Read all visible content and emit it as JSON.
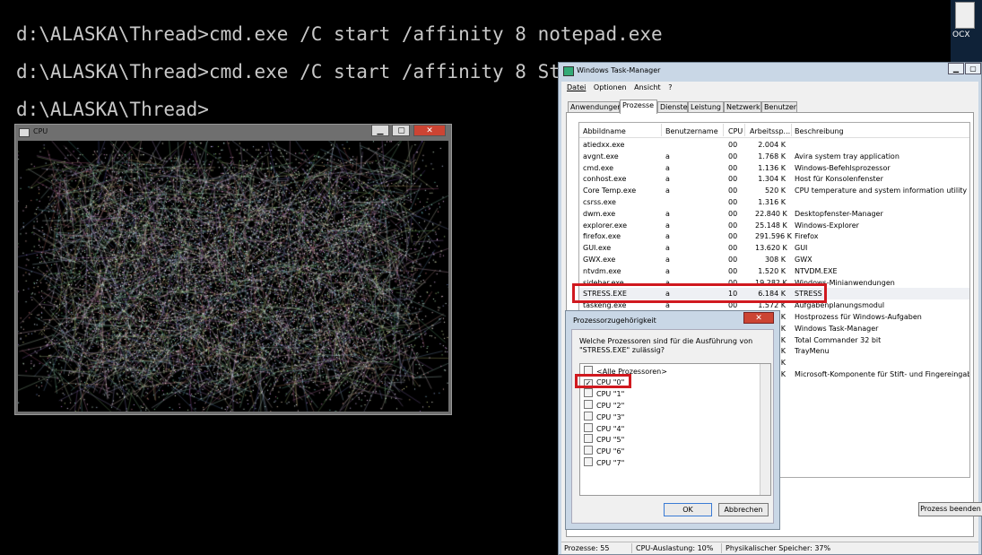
{
  "console": {
    "lines": [
      "d:\\ALASKA\\Thread>cmd.exe /C start /affinity 8 notepad.exe",
      "d:\\ALASKA\\Thread>cmd.exe /C start /affinity 8 St",
      "d:\\ALASKA\\Thread>"
    ]
  },
  "desktop": {
    "icon_label": "OCX"
  },
  "cpu_window": {
    "title": "CPU",
    "close_glyph": "✕",
    "min_glyph": "▁",
    "max_glyph": "▢"
  },
  "task_manager": {
    "title": "Windows Task-Manager",
    "menu": [
      "Datei",
      "Optionen",
      "Ansicht",
      "?"
    ],
    "tabs": [
      "Anwendungen",
      "Prozesse",
      "Dienste",
      "Leistung",
      "Netzwerk",
      "Benutzer"
    ],
    "active_tab": "Prozesse",
    "columns": [
      "Abbildname",
      "Benutzername",
      "CPU",
      "Arbeitssp...",
      "Beschreibung"
    ],
    "rows": [
      {
        "name": "atiedxx.exe",
        "user": "",
        "cpu": "00",
        "mem": "2.004 K",
        "desc": ""
      },
      {
        "name": "avgnt.exe",
        "user": "a",
        "cpu": "00",
        "mem": "1.768 K",
        "desc": "Avira system tray application"
      },
      {
        "name": "cmd.exe",
        "user": "a",
        "cpu": "00",
        "mem": "1.136 K",
        "desc": "Windows-Befehlsprozessor"
      },
      {
        "name": "conhost.exe",
        "user": "a",
        "cpu": "00",
        "mem": "1.304 K",
        "desc": "Host für Konsolenfenster"
      },
      {
        "name": "Core Temp.exe",
        "user": "a",
        "cpu": "00",
        "mem": "520 K",
        "desc": "CPU temperature and system information utility"
      },
      {
        "name": "csrss.exe",
        "user": "",
        "cpu": "00",
        "mem": "1.316 K",
        "desc": ""
      },
      {
        "name": "dwm.exe",
        "user": "a",
        "cpu": "00",
        "mem": "22.840 K",
        "desc": "Desktopfenster-Manager"
      },
      {
        "name": "explorer.exe",
        "user": "a",
        "cpu": "00",
        "mem": "25.148 K",
        "desc": "Windows-Explorer"
      },
      {
        "name": "firefox.exe",
        "user": "a",
        "cpu": "00",
        "mem": "291.596 K",
        "desc": "Firefox"
      },
      {
        "name": "GUI.exe",
        "user": "a",
        "cpu": "00",
        "mem": "13.620 K",
        "desc": "GUI"
      },
      {
        "name": "GWX.exe",
        "user": "a",
        "cpu": "00",
        "mem": "308 K",
        "desc": "GWX"
      },
      {
        "name": "ntvdm.exe",
        "user": "a",
        "cpu": "00",
        "mem": "1.520 K",
        "desc": "NTVDM.EXE"
      },
      {
        "name": "sidebar.exe",
        "user": "a",
        "cpu": "00",
        "mem": "19.282 K",
        "desc": "Windows-Minianwendungen"
      },
      {
        "name": "STRESS.EXE",
        "user": "a",
        "cpu": "10",
        "mem": "6.184 K",
        "desc": "STRESS"
      },
      {
        "name": "taskeng.exe",
        "user": "a",
        "cpu": "00",
        "mem": "1.572 K",
        "desc": "Aufgabenplanungsmodul"
      },
      {
        "name": "",
        "user": "",
        "cpu": "",
        "mem": "K",
        "desc": "Hostprozess für Windows-Aufgaben"
      },
      {
        "name": "",
        "user": "",
        "cpu": "",
        "mem": "K",
        "desc": "Windows Task-Manager"
      },
      {
        "name": "",
        "user": "",
        "cpu": "",
        "mem": "K",
        "desc": "Total Commander 32 bit"
      },
      {
        "name": "",
        "user": "",
        "cpu": "",
        "mem": "K",
        "desc": "TrayMenu"
      },
      {
        "name": "",
        "user": "",
        "cpu": "",
        "mem": "K",
        "desc": ""
      },
      {
        "name": "",
        "user": "",
        "cpu": "",
        "mem": "K",
        "desc": "Microsoft-Komponente für Stift- und Fingereingabe"
      }
    ],
    "end_process_button": "Prozess beenden",
    "status": {
      "processes": "Prozesse: 55",
      "cpu": "CPU-Auslastung: 10%",
      "memory": "Physikalischer Speicher: 37%"
    }
  },
  "affinity_dialog": {
    "title": "Prozessorzugehörigkeit",
    "question": "Welche Prozessoren sind für die Ausführung von \"STRESS.EXE\" zulässig?",
    "items": [
      {
        "label": "<Alle Prozessoren>",
        "checked": false
      },
      {
        "label": "CPU \"0\"",
        "checked": true
      },
      {
        "label": "CPU \"1\"",
        "checked": false
      },
      {
        "label": "CPU \"2\"",
        "checked": false
      },
      {
        "label": "CPU \"3\"",
        "checked": false
      },
      {
        "label": "CPU \"4\"",
        "checked": false
      },
      {
        "label": "CPU \"5\"",
        "checked": false
      },
      {
        "label": "CPU \"6\"",
        "checked": false
      },
      {
        "label": "CPU \"7\"",
        "checked": false
      }
    ],
    "ok_label": "OK",
    "cancel_label": "Abbrechen",
    "close_glyph": "✕"
  },
  "colors": {
    "highlight": "#d0191f",
    "console_text": "#c8c8c8"
  }
}
